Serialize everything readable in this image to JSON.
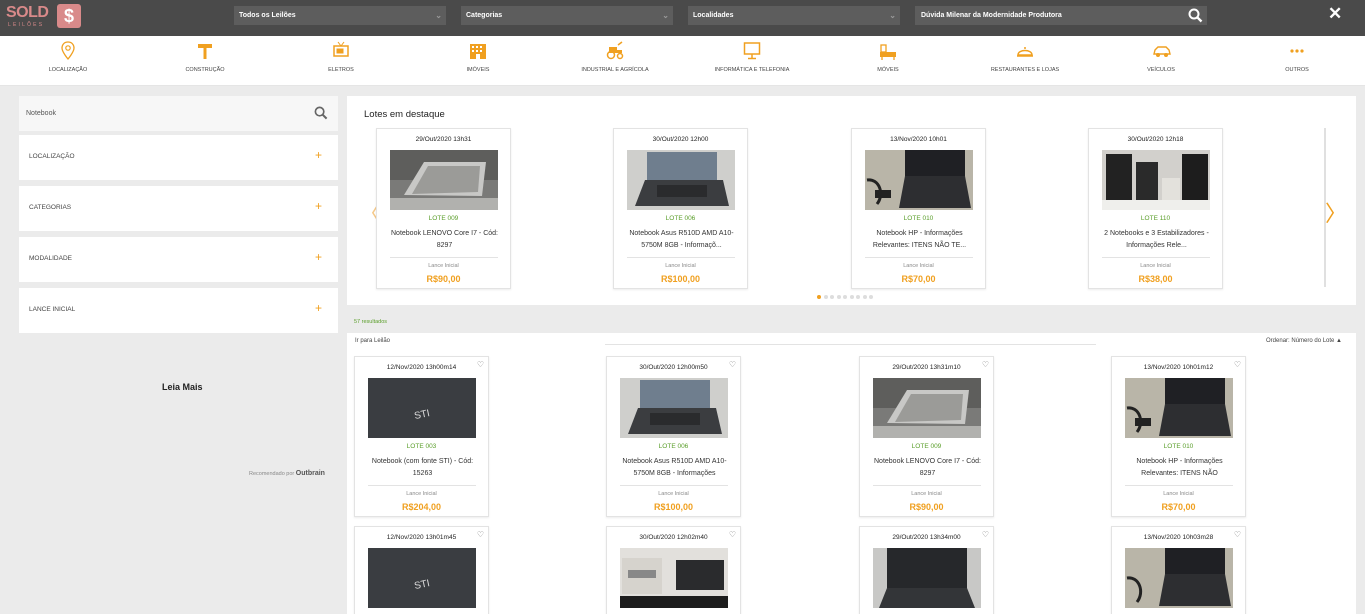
{
  "header": {
    "logo_text": "SOLD",
    "logo_sub": "LEILÕES",
    "logo_badge": "$",
    "selects": [
      "Todos os Leilões",
      "Categorias",
      "Localidades"
    ],
    "search_value": "Dúvida Milenar da Modernidade Produtora",
    "close_label": "✕"
  },
  "categories": [
    {
      "label": "LOCALIZAÇÃO",
      "icon": "location-pin-icon"
    },
    {
      "label": "CONSTRUÇÃO",
      "icon": "hammer-icon"
    },
    {
      "label": "ELETROS",
      "icon": "tv-icon"
    },
    {
      "label": "IMÓVEIS",
      "icon": "building-icon"
    },
    {
      "label": "INDUSTRIAL E AGRÍCOLA",
      "icon": "tractor-icon"
    },
    {
      "label": "INFORMÁTICA E TELEFONIA",
      "icon": "monitor-icon"
    },
    {
      "label": "MÓVEIS",
      "icon": "furniture-icon"
    },
    {
      "label": "RESTAURANTES E LOJAS",
      "icon": "cloche-icon"
    },
    {
      "label": "VEÍCULOS",
      "icon": "car-icon"
    },
    {
      "label": "OUTROS",
      "icon": "dots-icon"
    }
  ],
  "sidebar": {
    "search_value": "Notebook",
    "filters": [
      "LOCALIZAÇÃO",
      "CATEGORIAS",
      "MODALIDADE",
      "LANCE INICIAL"
    ],
    "filter_toggle": "+",
    "leia_mais": "Leia Mais",
    "recommended_prefix": "Recomendado por",
    "recommended_brand": "Outbrain"
  },
  "featured": {
    "title": "Lotes em destaque",
    "prev": "〈",
    "next": "〉",
    "dots": 9,
    "active_dot": 0,
    "cards": [
      {
        "date": "29/Out/2020 13h31",
        "lote": "LOTE 009",
        "title": "Notebook LENOVO Core I7 - Cód: 8297",
        "label": "Lance Inicial",
        "price": "R$90,00"
      },
      {
        "date": "30/Out/2020 12h00",
        "lote": "LOTE 006",
        "title": "Notebook Asus R510D AMD A10-5750M 8GB - Informaçõ...",
        "label": "Lance Inicial",
        "price": "R$100,00"
      },
      {
        "date": "13/Nov/2020 10h01",
        "lote": "LOTE 010",
        "title": "Notebook HP - Informações Relevantes: ITENS NÃO TE...",
        "label": "Lance Inicial",
        "price": "R$70,00"
      },
      {
        "date": "30/Out/2020 12h18",
        "lote": "LOTE 110",
        "title": "2 Notebooks e 3 Estabilizadores - Informações Rele...",
        "label": "Lance Inicial",
        "price": "R$38,00"
      }
    ]
  },
  "results": {
    "count": "57 resultados",
    "go_to": "Ir para Leilão",
    "order": "Ordenar: Número do Lote ▲",
    "heart": "♡",
    "cards": [
      {
        "date": "12/Nov/2020 13h00m14",
        "lote": "LOTE 003",
        "title": "Notebook (com fonte STI) - Cód: 15263",
        "label": "Lance Inicial",
        "price": "R$204,00"
      },
      {
        "date": "30/Out/2020 12h00m50",
        "lote": "LOTE 006",
        "title": "Notebook Asus R510D AMD A10-5750M 8GB - Informações",
        "label": "Lance Inicial",
        "price": "R$100,00"
      },
      {
        "date": "29/Out/2020 13h31m10",
        "lote": "LOTE 009",
        "title": "Notebook LENOVO Core I7 - Cód: 8297",
        "label": "Lance Inicial",
        "price": "R$90,00"
      },
      {
        "date": "13/Nov/2020 10h01m12",
        "lote": "LOTE 010",
        "title": "Notebook HP - Informações Relevantes: ITENS NÃO",
        "label": "Lance Inicial",
        "price": "R$70,00"
      },
      {
        "date": "12/Nov/2020 13h01m45"
      },
      {
        "date": "30/Out/2020 12h02m40"
      },
      {
        "date": "29/Out/2020 13h34m00"
      },
      {
        "date": "13/Nov/2020 10h03m28"
      }
    ]
  },
  "colors": {
    "accent": "#f0a020",
    "lote_green": "#5a9e2a",
    "header_bg": "#4a4a4a",
    "logo_pink": "#d98a8a"
  }
}
